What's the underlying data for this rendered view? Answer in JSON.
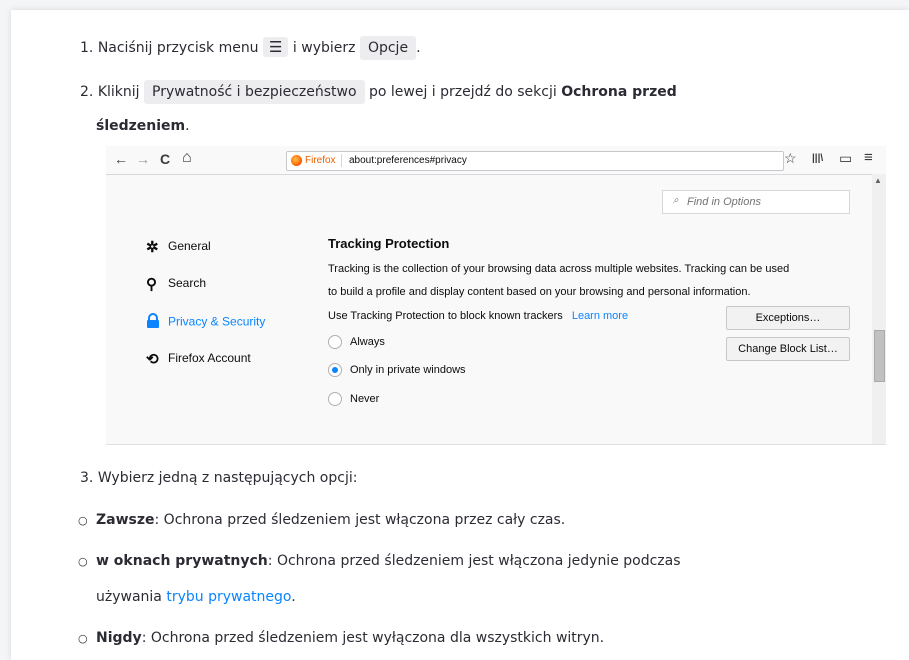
{
  "step1": {
    "number": "1.",
    "text_a": "Naciśnij przycisk menu",
    "menu_glyph": "☰",
    "text_b": "i wybierz",
    "button": "Opcje",
    "text_c": "."
  },
  "step2": {
    "number": "2.",
    "text_a": "Kliknij",
    "button": "Prywatność i bezpieczeństwo",
    "text_b": "po lewej i przejdź do sekcji",
    "bold_a": "Ochrona przed",
    "bold_b": "śledzeniem",
    "text_c": "."
  },
  "screenshot": {
    "toolbar": {
      "back_icon": "←",
      "forward_icon": "→",
      "reload_icon": "C",
      "home_icon": "⌂",
      "brand": "Firefox",
      "address": "about:preferences#privacy",
      "star_icon": "☆",
      "library_icon": "|||\\",
      "sidebar_icon": "▭",
      "menu_icon": "≡"
    },
    "find_placeholder": "Find in Options",
    "nav": [
      {
        "label": "General",
        "icon": "gear-icon"
      },
      {
        "label": "Search",
        "icon": "search-icon"
      },
      {
        "label": "Privacy & Security",
        "icon": "lock-icon"
      },
      {
        "label": "Firefox Account",
        "icon": "sync-icon"
      }
    ],
    "section_title": "Tracking Protection",
    "desc_line1": "Tracking is the collection of your browsing data across multiple websites. Tracking can be used",
    "desc_line2": "to build a profile and display content based on your browsing and personal information.",
    "desc_line3": "Use Tracking Protection to block known trackers",
    "learn_more": "Learn more",
    "exceptions_button": "Exceptions…",
    "change_block_list_button": "Change Block List…",
    "radios": [
      {
        "label": "Always",
        "checked": false
      },
      {
        "label": "Only in private windows",
        "checked": true
      },
      {
        "label": "Never",
        "checked": false
      }
    ]
  },
  "step3": {
    "number": "3.",
    "text": "Wybierz jedną z następujących opcji:"
  },
  "options": [
    {
      "bold": "Zawsze",
      "text": ": Ochrona przed śledzeniem jest włączona przez cały czas."
    },
    {
      "bold": "w oknach prywatnych",
      "text": ": Ochrona przed śledzeniem jest włączona jedynie podczas",
      "text2": "używania",
      "link": "trybu prywatnego",
      "text3": "."
    },
    {
      "bold": "Nigdy",
      "text": ": Ochrona przed śledzeniem jest wyłączona dla wszystkich witryn."
    }
  ],
  "colors": {
    "link": "#0a84ff",
    "highlight": "#ededf0",
    "brand": "#e66000"
  }
}
